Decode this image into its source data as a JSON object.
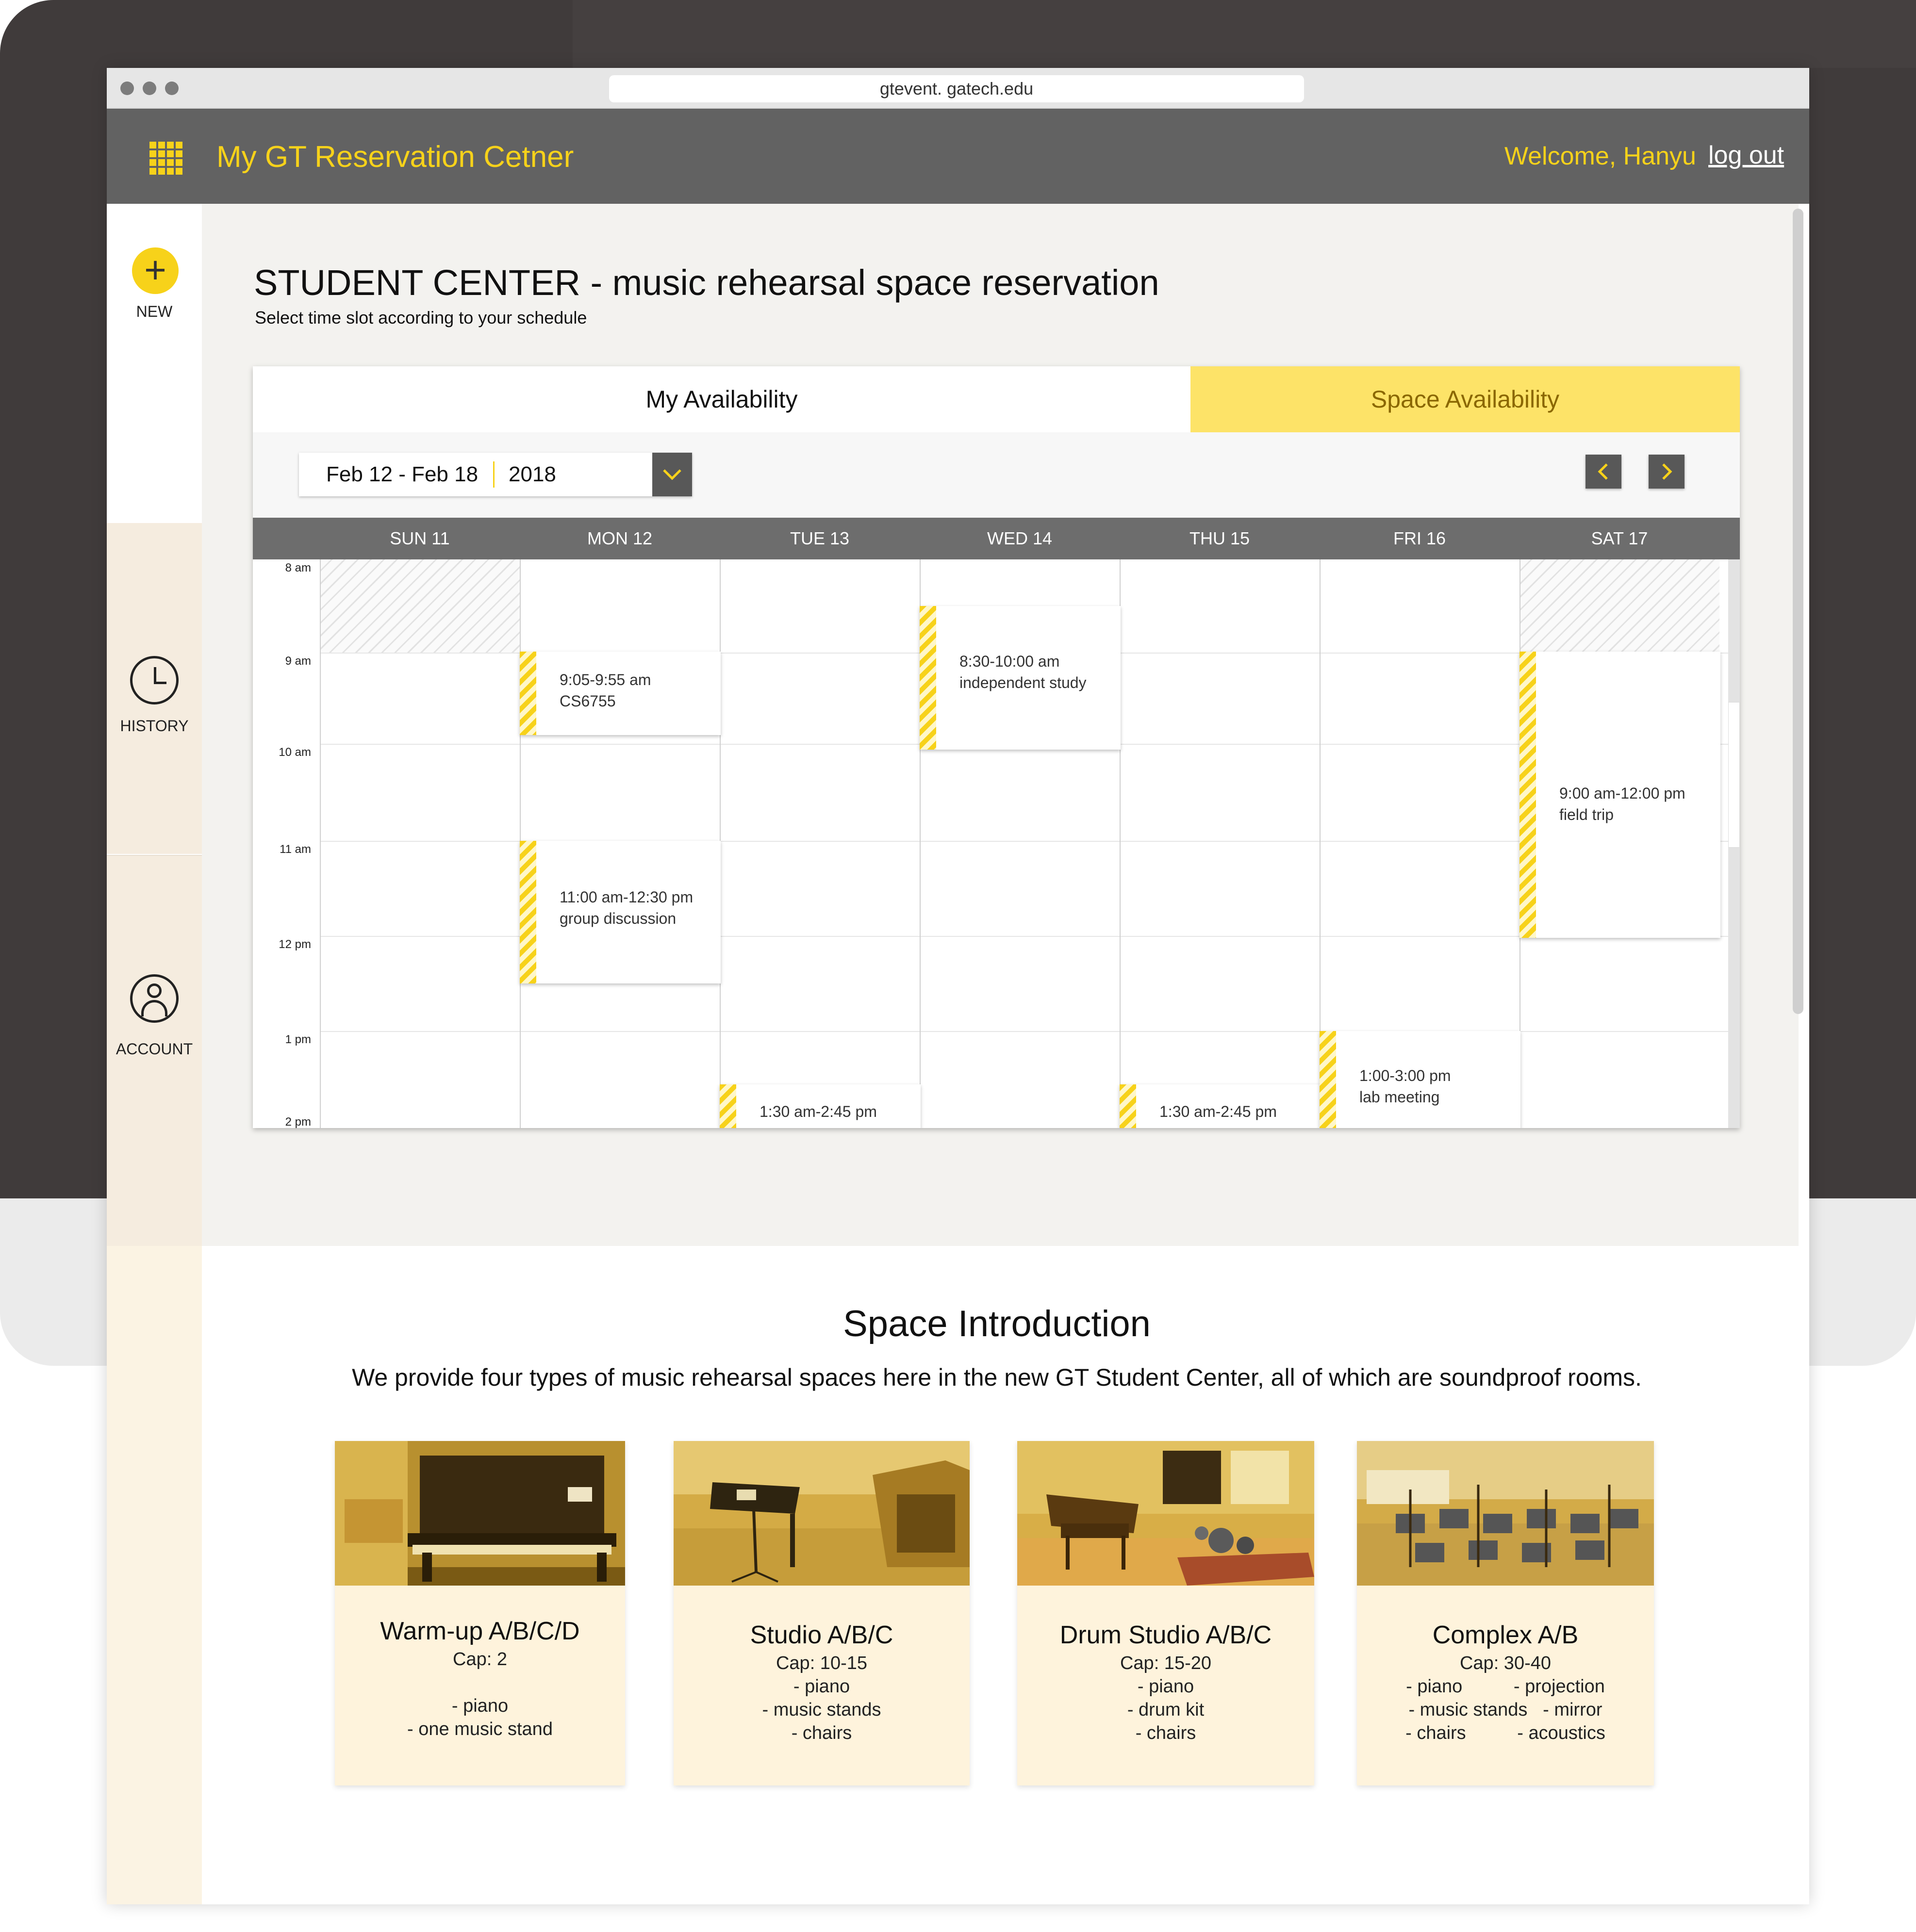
{
  "browser": {
    "url": "gtevent. gatech.edu"
  },
  "header": {
    "app_title": "My GT Reservation Cetner",
    "welcome": "Welcome, Hanyu",
    "logout": "log out"
  },
  "sidebar": {
    "new_label": "NEW",
    "history_label": "HISTORY",
    "account_label": "ACCOUNT"
  },
  "page": {
    "title": "STUDENT CENTER - music rehearsal space reservation",
    "subtitle": "Select time slot according to your schedule"
  },
  "calendar": {
    "tabs": [
      "My Availability",
      "Space Availability"
    ],
    "active_tab": "Space Availability",
    "date_range": "Feb 12 - Feb 18",
    "year": "2018",
    "days": [
      "SUN 11",
      "MON 12",
      "TUE 13",
      "WED 14",
      "THU 15",
      "FRI 16",
      "SAT 17"
    ],
    "hours": [
      "8 am",
      "9 am",
      "10 am",
      "11 am",
      "12 pm",
      "1 pm",
      "2 pm"
    ],
    "events": [
      {
        "day": "MON 12",
        "time": "9:05-9:55 am",
        "title": "CS6755"
      },
      {
        "day": "MON 12",
        "time": "11:00 am-12:30 pm",
        "title": "group discussion"
      },
      {
        "day": "TUE 13",
        "time": "1:30 am-2:45 pm",
        "title": ""
      },
      {
        "day": "WED 14",
        "time": "8:30-10:00 am",
        "title": "independent study"
      },
      {
        "day": "THU 15",
        "time": "1:30 am-2:45 pm",
        "title": ""
      },
      {
        "day": "FRI 16",
        "time": "1:00-3:00 pm",
        "title": "lab meeting"
      },
      {
        "day": "SAT 17",
        "time": "9:00 am-12:00 pm",
        "title": "field trip"
      }
    ],
    "colors": {
      "accent": "#f7d21a",
      "header": "#626262",
      "tab_active": "#fde368"
    }
  },
  "intro": {
    "title": "Space Introduction",
    "text": "We provide four types of music rehearsal spaces here in the new GT Student Center, all of which are soundproof rooms.",
    "rooms": [
      {
        "name": "Warm-up A/B/C/D",
        "desc": "Cap: 2\n\n- piano\n- one music stand"
      },
      {
        "name": "Studio A/B/C",
        "desc": "Cap: 10-15\n- piano\n- music stands\n- chairs"
      },
      {
        "name": "Drum Studio A/B/C",
        "desc": "Cap: 15-20\n- piano\n- drum kit\n- chairs"
      },
      {
        "name": "Complex A/B",
        "desc": "Cap: 30-40\n- piano          - projection\n- music stands   - mirror\n- chairs          - acoustics"
      }
    ]
  }
}
